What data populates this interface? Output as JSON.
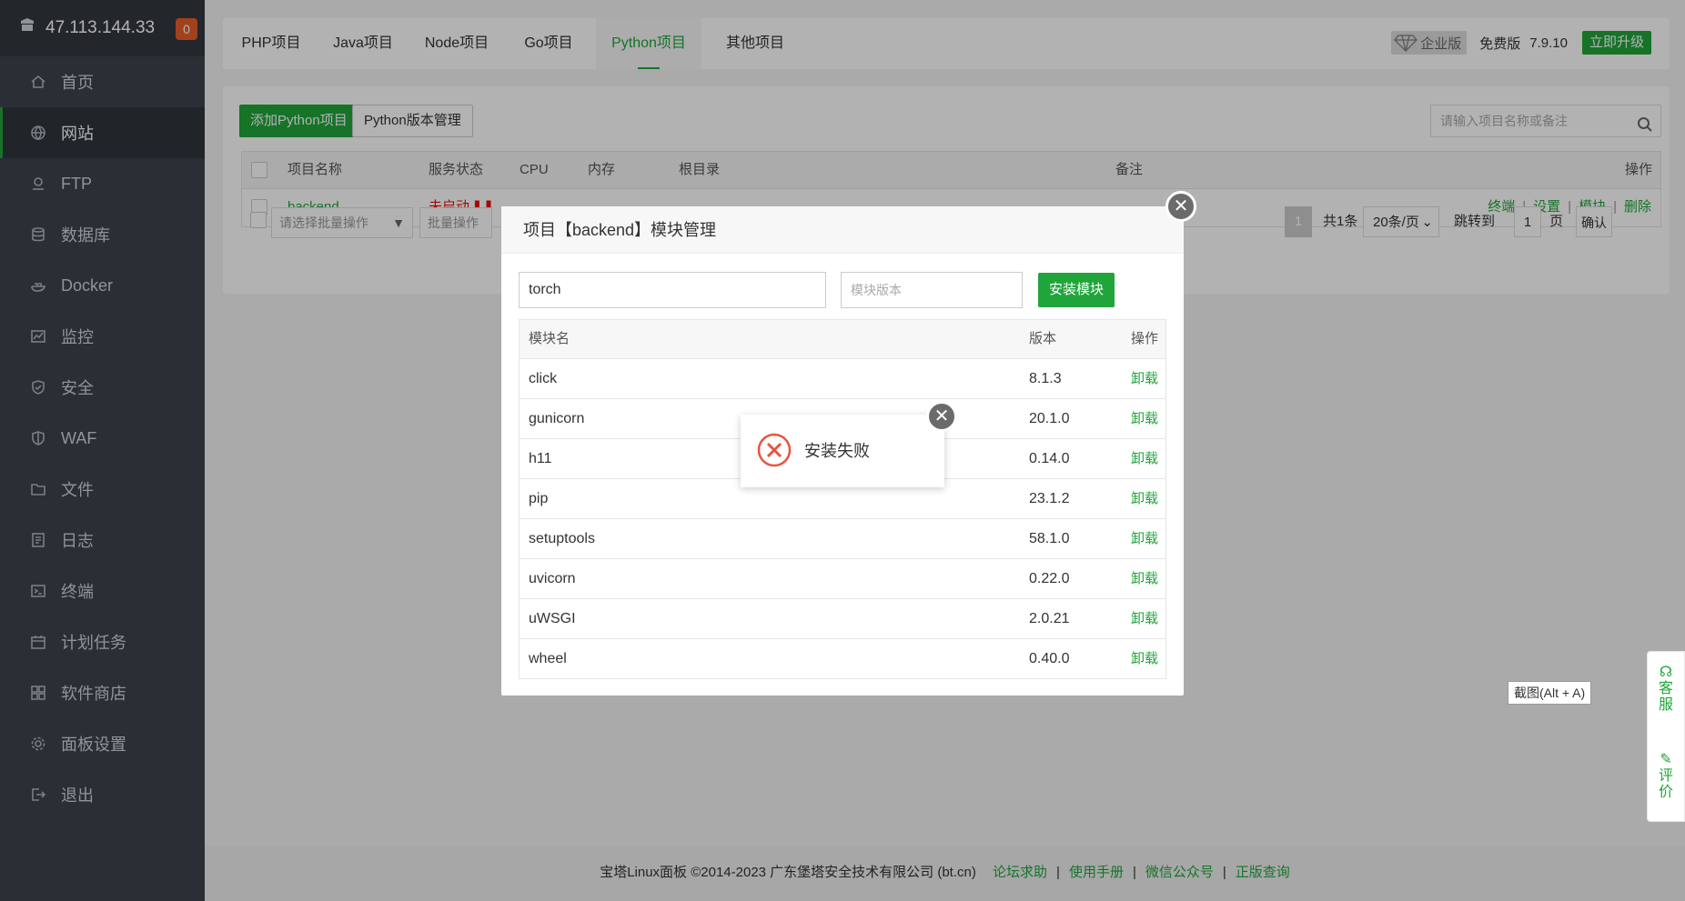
{
  "sidebar": {
    "ip": "47.113.144.33",
    "badge": "0",
    "items": [
      {
        "label": "首页"
      },
      {
        "label": "网站"
      },
      {
        "label": "FTP"
      },
      {
        "label": "数据库"
      },
      {
        "label": "Docker"
      },
      {
        "label": "监控"
      },
      {
        "label": "安全"
      },
      {
        "label": "WAF"
      },
      {
        "label": "文件"
      },
      {
        "label": "日志"
      },
      {
        "label": "终端"
      },
      {
        "label": "计划任务"
      },
      {
        "label": "软件商店"
      },
      {
        "label": "面板设置"
      },
      {
        "label": "退出"
      }
    ]
  },
  "tabs": [
    "PHP项目",
    "Java项目",
    "Node项目",
    "Go项目",
    "Python项目",
    "其他项目"
  ],
  "header": {
    "enterprise": "企业版",
    "free": "免费版",
    "version": "7.9.10",
    "upgrade": "立即升级"
  },
  "toolbar": {
    "add": "添加Python项目",
    "version_mgr": "Python版本管理",
    "search_placeholder": "请输入项目名称或备注"
  },
  "table": {
    "headers": {
      "name": "项目名称",
      "status": "服务状态",
      "cpu": "CPU",
      "mem": "内存",
      "root": "根目录",
      "remark": "备注",
      "ops": "操作"
    },
    "row": {
      "name": "backend",
      "status": "未启动"
    },
    "row_ops": [
      "终端",
      "设置",
      "模块",
      "删除"
    ]
  },
  "bulk": {
    "select": "请选择批量操作",
    "action": "批量操作"
  },
  "pager": {
    "page": "1",
    "total": "共1条",
    "per_page": "20条/页",
    "jump": "跳转到",
    "jump_val": "1",
    "unit": "页",
    "confirm": "确认"
  },
  "modal": {
    "title": "项目【backend】模块管理",
    "module_input": "torch",
    "version_placeholder": "模块版本",
    "install": "安装模块",
    "col_name": "模块名",
    "col_version": "版本",
    "col_op": "操作",
    "modules": [
      {
        "name": "click",
        "version": "8.1.3",
        "op": "卸载"
      },
      {
        "name": "gunicorn",
        "version": "20.1.0",
        "op": "卸载"
      },
      {
        "name": "h11",
        "version": "0.14.0",
        "op": "卸载"
      },
      {
        "name": "pip",
        "version": "23.1.2",
        "op": "卸载"
      },
      {
        "name": "setuptools",
        "version": "58.1.0",
        "op": "卸载"
      },
      {
        "name": "uvicorn",
        "version": "0.22.0",
        "op": "卸载"
      },
      {
        "name": "uWSGI",
        "version": "2.0.21",
        "op": "卸载"
      },
      {
        "name": "wheel",
        "version": "0.40.0",
        "op": "卸载"
      }
    ]
  },
  "toast": {
    "message": "安装失败"
  },
  "screenshot_tip": "截图(Alt + A)",
  "side_tools": {
    "service": "客服",
    "review": "评价"
  },
  "footer": {
    "copyright": "宝塔Linux面板 ©2014-2023 广东堡塔安全技术有限公司 (bt.cn)",
    "links": [
      "论坛求助",
      "使用手册",
      "微信公众号",
      "正版查询"
    ]
  },
  "colors": {
    "accent": "#20a53a",
    "sidebar": "#3c444d",
    "danger": "#ef0808"
  }
}
